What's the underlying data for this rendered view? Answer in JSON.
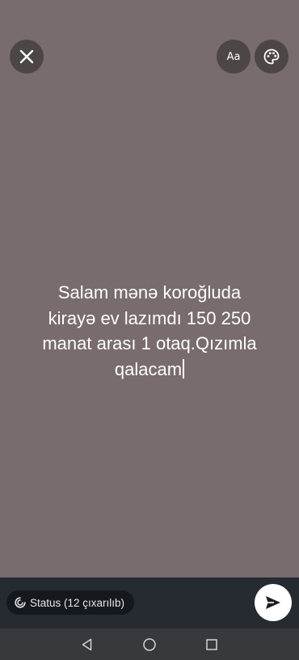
{
  "colors": {
    "background": "#786c6d",
    "bottom_bar": "#262b31",
    "nav_bar": "#37393c",
    "text": "#ffffff"
  },
  "toolbar": {
    "close_icon": "close-icon",
    "font_button_label": "Aa",
    "palette_icon": "palette-icon"
  },
  "status": {
    "text_lines": [
      "Salam mənə koroğluda",
      "kirayə ev lazımdı 150 250",
      "manat arası 1 otaq.Qızımla",
      "qalacam"
    ]
  },
  "audience": {
    "label": "Status (12 çıxarılıb)",
    "icon": "status-ring-icon"
  },
  "send": {
    "icon": "send-icon"
  },
  "system_nav": {
    "back_icon": "back-triangle-icon",
    "home_icon": "home-circle-icon",
    "recents_icon": "recents-square-icon"
  }
}
